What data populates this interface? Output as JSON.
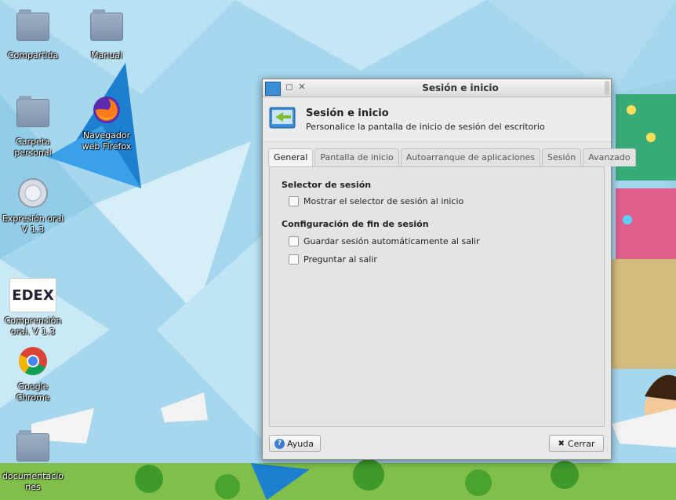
{
  "desktop": {
    "icons": [
      {
        "label": "Compartida",
        "icon": "shared-folder-icon"
      },
      {
        "label": "Manual",
        "icon": "folder-icon"
      },
      {
        "label": "Carpeta personal",
        "icon": "home-folder-icon"
      },
      {
        "label": "Navegador web Firefox",
        "icon": "firefox-icon"
      },
      {
        "label": "Expresión oral V 1.3",
        "icon": "app-disc-icon"
      },
      {
        "label": "EDEX",
        "icon": "edex-logo"
      },
      {
        "label": "Comprensión oral. V 1.3",
        "icon": "edex-app-icon"
      },
      {
        "label": "Google Chrome",
        "icon": "chrome-icon"
      },
      {
        "label": "documentaciones",
        "icon": "folder-icon"
      }
    ]
  },
  "window": {
    "title": "Sesión e inicio",
    "header_title": "Sesión e inicio",
    "header_subtitle": "Personalice la pantalla de inicio de sesión del escritorio",
    "tabs": [
      {
        "label": "General",
        "active": true
      },
      {
        "label": "Pantalla de inicio",
        "active": false
      },
      {
        "label": "Autoarranque de aplicaciones",
        "active": false
      },
      {
        "label": "Sesión",
        "active": false
      },
      {
        "label": "Avanzado",
        "active": false
      }
    ],
    "sections": [
      {
        "title": "Selector de sesión",
        "options": [
          {
            "label": "Mostrar el selector de sesión al inicio",
            "checked": false
          }
        ]
      },
      {
        "title": "Configuración de fin de sesión",
        "options": [
          {
            "label": "Guardar sesión automáticamente al salir",
            "checked": false
          },
          {
            "label": "Preguntar al salir",
            "checked": false
          }
        ]
      }
    ],
    "help_button": "Ayuda",
    "close_button": "Cerrar",
    "close_glyph": "✖",
    "title_close_glyph": "✕",
    "title_max_glyph": "◻"
  },
  "colors": {
    "accent": "#3c7fd1",
    "window_bg": "#e8e8e8"
  }
}
